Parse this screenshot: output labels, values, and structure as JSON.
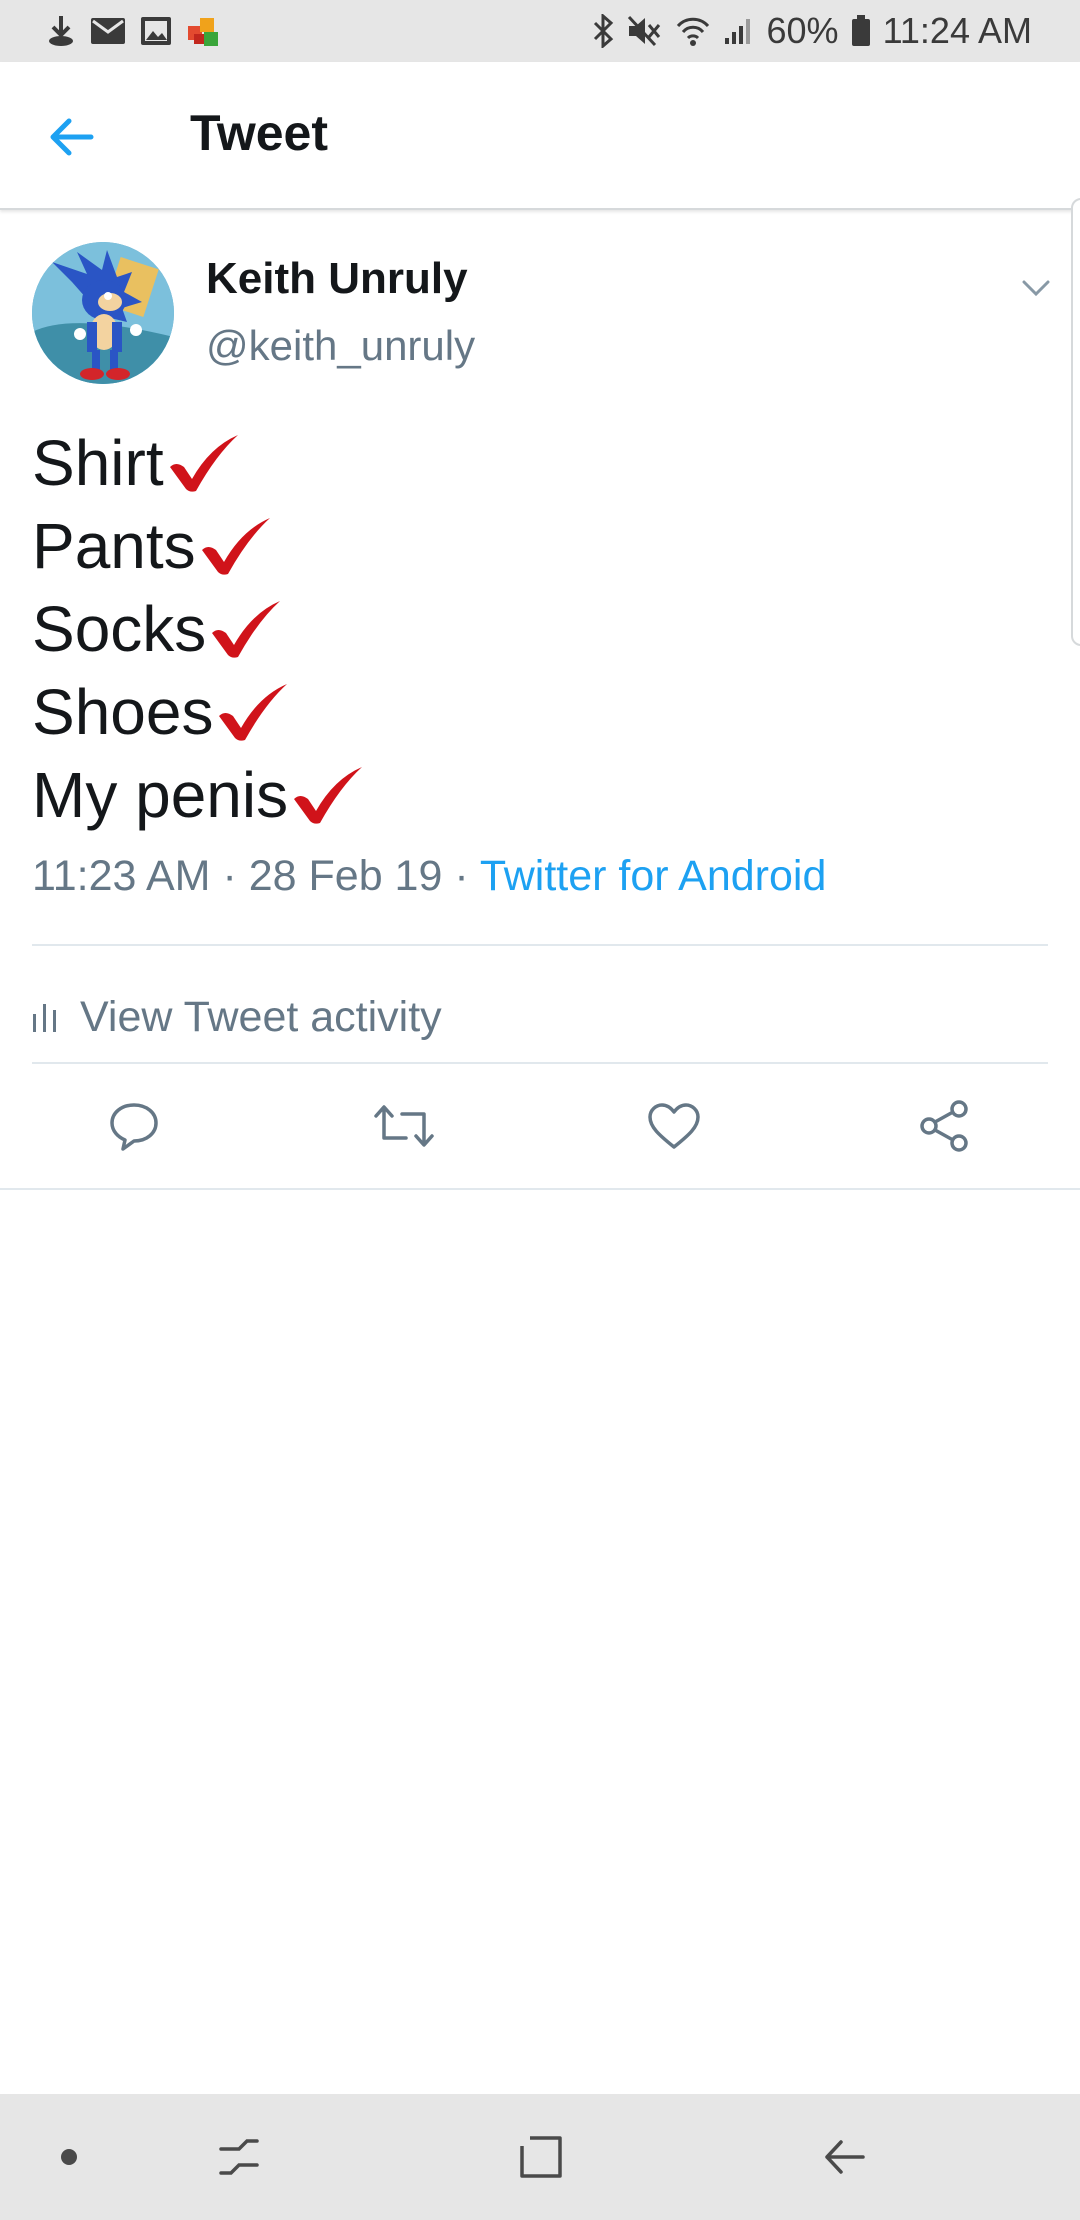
{
  "status_bar": {
    "battery": "60%",
    "time": "11:24 AM",
    "left_icons": [
      "download-icon",
      "mail-icon",
      "gallery-icon",
      "app-notification-icon"
    ],
    "right_icons": [
      "bluetooth-icon",
      "mute-icon",
      "wifi-icon",
      "signal-icon",
      "battery-icon"
    ]
  },
  "header": {
    "title": "Tweet"
  },
  "tweet": {
    "author_name": "Keith Unruly",
    "author_handle": "@keith_unruly",
    "lines": [
      {
        "text": "Shirt"
      },
      {
        "text": "Pants"
      },
      {
        "text": "Socks"
      },
      {
        "text": "Shoes"
      },
      {
        "text": "My penis"
      }
    ],
    "time": "11:23 AM",
    "separator": "·",
    "date": "28 Feb 19",
    "source": "Twitter for Android"
  },
  "activity": {
    "label": "View Tweet activity"
  },
  "actions": [
    "reply-icon",
    "retweet-icon",
    "like-icon",
    "share-icon"
  ],
  "colors": {
    "accent": "#1da1f2",
    "text_primary": "#14171a",
    "text_secondary": "#657786",
    "check": "#d0131a",
    "system_bar": "#e6e6e6"
  }
}
